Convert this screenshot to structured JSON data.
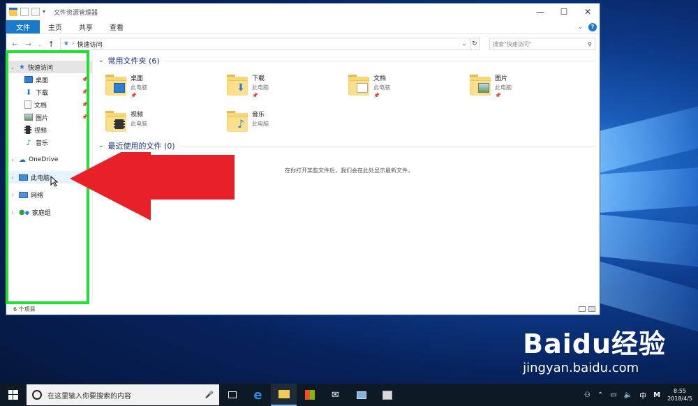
{
  "window": {
    "title": "文件资源管理器",
    "ribbon_tabs": [
      "文件",
      "主页",
      "共享",
      "查看"
    ]
  },
  "address": {
    "path": "快速访问",
    "search_placeholder": "搜索\"快速访问\""
  },
  "nav_pane": {
    "quick_access": "快速访问",
    "pinned": [
      {
        "label": "桌面",
        "icon": "desktop-icon"
      },
      {
        "label": "下载",
        "icon": "download-icon"
      },
      {
        "label": "文档",
        "icon": "document-icon"
      },
      {
        "label": "图片",
        "icon": "picture-icon"
      }
    ],
    "recent": [
      {
        "label": "视频",
        "icon": "video-icon"
      },
      {
        "label": "音乐",
        "icon": "music-icon"
      }
    ],
    "roots": [
      {
        "label": "OneDrive",
        "icon": "onedrive-icon"
      },
      {
        "label": "此电脑",
        "icon": "this-pc-icon"
      },
      {
        "label": "网络",
        "icon": "network-icon"
      },
      {
        "label": "家庭组",
        "icon": "homegroup-icon"
      }
    ]
  },
  "content": {
    "frequent_header": "常用文件夹 (6)",
    "folders": [
      {
        "name": "桌面",
        "location": "此电脑",
        "pinned": true,
        "emblem": "desktop"
      },
      {
        "name": "下载",
        "location": "此电脑",
        "pinned": true,
        "emblem": "download"
      },
      {
        "name": "文档",
        "location": "此电脑",
        "pinned": true,
        "emblem": "document"
      },
      {
        "name": "图片",
        "location": "此电脑",
        "pinned": true,
        "emblem": "picture"
      },
      {
        "name": "视频",
        "location": "此电脑",
        "pinned": false,
        "emblem": "video"
      },
      {
        "name": "音乐",
        "location": "此电脑",
        "pinned": false,
        "emblem": "music"
      }
    ],
    "recent_header": "最近使用的文件 (0)",
    "recent_empty": "在你打开某些文件后，我们会在此处显示最新文件。"
  },
  "status": {
    "count": "6 个项目"
  },
  "taskbar": {
    "search_placeholder": "在这里输入你要搜索的内容",
    "ime": "中",
    "ime2": "M",
    "time": "8:55",
    "date": "2018/4/5"
  },
  "watermark": {
    "brand": "Baidu经验",
    "url": "jingyan.baidu.com"
  },
  "colors": {
    "ribbon_file": "#1979ca",
    "highlight_box": "#22e033",
    "arrow": "#e8202a"
  }
}
